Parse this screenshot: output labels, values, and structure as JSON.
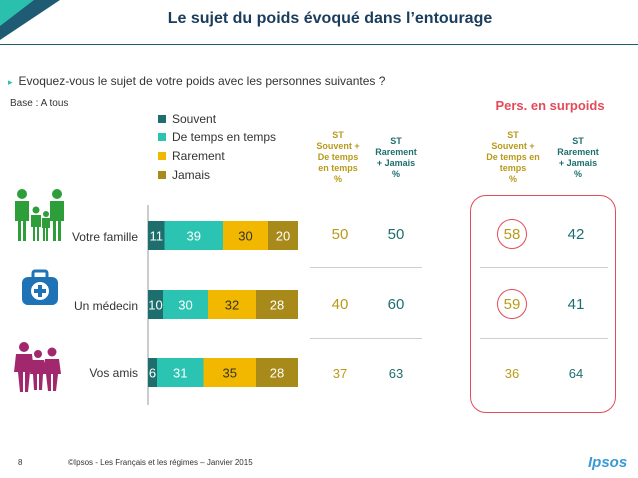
{
  "header": {
    "title": "Le sujet du poids évoqué dans l’entourage"
  },
  "question": "Evoquez-vous le sujet de votre poids avec les personnes suivantes ?",
  "base": "Base : A tous",
  "group_title": "Pers. en surpoids",
  "column_headers": {
    "st_often": [
      "ST",
      "Souvent +",
      "De temps",
      "en temps",
      "%"
    ],
    "st_rare": [
      "ST",
      "Rarement",
      "+ Jamais",
      "%"
    ],
    "st_often_grp": [
      "ST",
      "Souvent +",
      "De temps en",
      "temps",
      "%"
    ],
    "st_rare_grp": [
      "ST",
      "Rarement",
      "+ Jamais",
      "%"
    ]
  },
  "colors": {
    "souvent": "#1f6e6e",
    "de_temps": "#2bc4b3",
    "rarement": "#f2b800",
    "jamais": "#a88a1a",
    "gold_text": "#b89a1a",
    "teal_text": "#1f6e6e",
    "accent_red": "#e34b5a",
    "people_green": "#2e9e3a",
    "doctor_blue": "#1d73b6",
    "friends_purple": "#a2286e"
  },
  "icons": [
    "family-icon",
    "medical-kit-icon",
    "friends-icon"
  ],
  "chart_data": {
    "type": "bar",
    "orientation": "horizontal",
    "stacked": true,
    "xlim": [
      0,
      100
    ],
    "categories": [
      "Votre famille",
      "Un médecin",
      "Vos amis"
    ],
    "series": [
      {
        "name": "Souvent",
        "values": [
          11,
          10,
          6
        ]
      },
      {
        "name": "De temps en temps",
        "values": [
          39,
          30,
          31
        ]
      },
      {
        "name": "Rarement",
        "values": [
          30,
          32,
          35
        ]
      },
      {
        "name": "Jamais",
        "values": [
          20,
          28,
          28
        ]
      }
    ],
    "legend_position": "top"
  },
  "summary": {
    "st_often": [
      "50",
      "40",
      "37"
    ],
    "st_rare": [
      "50",
      "60",
      "63"
    ],
    "st_often_grp": [
      "58",
      "59",
      "36"
    ],
    "st_rare_grp": [
      "42",
      "41",
      "64"
    ]
  },
  "footer": {
    "page_number": "8",
    "text": "©Ipsos - Les Français et les régimes – Janvier 2015",
    "logo": "Ipsos"
  }
}
